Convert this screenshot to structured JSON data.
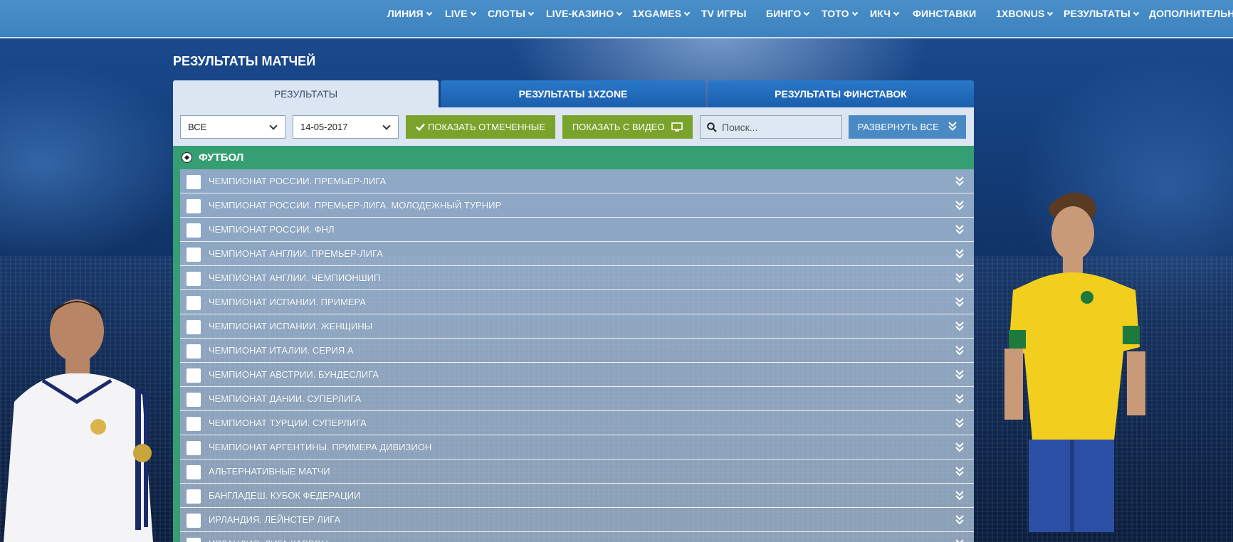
{
  "nav": {
    "items": [
      {
        "label": "ЛИНИЯ",
        "dropdown": true
      },
      {
        "label": "LIVE",
        "dropdown": true
      },
      {
        "label": "СЛОТЫ",
        "dropdown": true
      },
      {
        "label": "LIVE-КАЗИНО",
        "dropdown": true
      },
      {
        "label": "1XGAMES",
        "dropdown": true
      },
      {
        "label": "TV ИГРЫ",
        "dropdown": false
      },
      {
        "label": "БИНГО",
        "dropdown": true
      },
      {
        "label": "ТОТО",
        "dropdown": true
      },
      {
        "label": "ИКЧ",
        "dropdown": true
      },
      {
        "label": "ФИНСТАВКИ",
        "dropdown": false
      },
      {
        "label": "1XBONUS",
        "dropdown": true
      },
      {
        "label": "РЕЗУЛЬТАТЫ",
        "dropdown": true
      },
      {
        "label": "ДОПОЛНИТЕЛЬНО",
        "dropdown": false
      }
    ]
  },
  "page_title": "РЕЗУЛЬТАТЫ МАТЧЕЙ",
  "tabs": [
    {
      "label": "РЕЗУЛЬТАТЫ",
      "active": true
    },
    {
      "label": "РЕЗУЛЬТАТЫ 1XZONE",
      "active": false
    },
    {
      "label": "РЕЗУЛЬТАТЫ ФИНСТАВОК",
      "active": false
    }
  ],
  "filters": {
    "sport_select_value": "ВСЕ",
    "date_select_value": "14-05-2017",
    "show_marked_label": "ПОКАЗАТЬ ОТМЕЧЕННЫЕ",
    "show_video_label": "ПОКАЗАТЬ С ВИДЕО",
    "search_placeholder": "Поиск...",
    "expand_all_label": "РАЗВЕРНУТЬ ВСЕ"
  },
  "sport": {
    "name": "ФУТБОЛ",
    "leagues": [
      "ЧЕМПИОНАТ РОССИИ. ПРЕМЬЕР-ЛИГА",
      "ЧЕМПИОНАТ РОССИИ. ПРЕМЬЕР-ЛИГА. МОЛОДЕЖНЫЙ ТУРНИР",
      "ЧЕМПИОНАТ РОССИИ. ФНЛ",
      "ЧЕМПИОНАТ АНГЛИИ. ПРЕМЬЕР-ЛИГА",
      "ЧЕМПИОНАТ АНГЛИИ. ЧЕМПИОНШИП",
      "ЧЕМПИОНАТ ИСПАНИИ. ПРИМЕРА",
      "ЧЕМПИОНАТ ИСПАНИИ. ЖЕНЩИНЫ",
      "ЧЕМПИОНАТ ИТАЛИИ. СЕРИЯ А",
      "ЧЕМПИОНАТ АВСТРИИ. БУНДЕСЛИГА",
      "ЧЕМПИОНАТ ДАНИИ. СУПЕРЛИГА",
      "ЧЕМПИОНАТ ТУРЦИИ. СУПЕРЛИГА",
      "ЧЕМПИОНАТ АРГЕНТИНЫ. ПРИМЕРА ДИВИЗИОН",
      "АЛЬТЕРНАТИВНЫЕ МАТЧИ",
      "БАНГЛАДЕШ. КУБОК ФЕДЕРАЦИИ",
      "ИРЛАНДИЯ. ЛЕЙНСТЕР ЛИГА",
      "ИРЛАНДИЯ. ЛИГА КАРРОН"
    ]
  },
  "colors": {
    "nav_bg": "#3d82bf",
    "sport_header": "#359e72",
    "green_button": "#7aa32c",
    "blue_button": "#4a8ac4",
    "tab_active": "#dbe6f2",
    "tab_inactive": "#1a5fad"
  },
  "icons": {
    "nav_dropdown": "chevron-down-icon",
    "checkmark": "check-icon",
    "video": "monitor-icon",
    "search": "search-icon",
    "expand": "double-chevron-down-icon",
    "football": "soccer-ball-icon"
  }
}
